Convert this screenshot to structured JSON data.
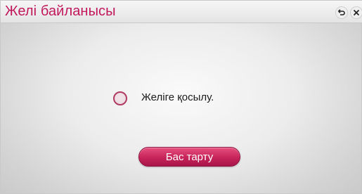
{
  "window": {
    "title": "Желі байланысы"
  },
  "title_buttons": {
    "back_icon": "back-arrow-icon",
    "close_icon": "close-icon"
  },
  "status": {
    "text": "Желіге қосылу.",
    "indicator_icon": "loading-spinner-icon"
  },
  "actions": {
    "cancel_label": "Бас тарту"
  },
  "colors": {
    "accent": "#c7245a",
    "title_text": "#c2185b",
    "background": "#e6e6e6"
  }
}
